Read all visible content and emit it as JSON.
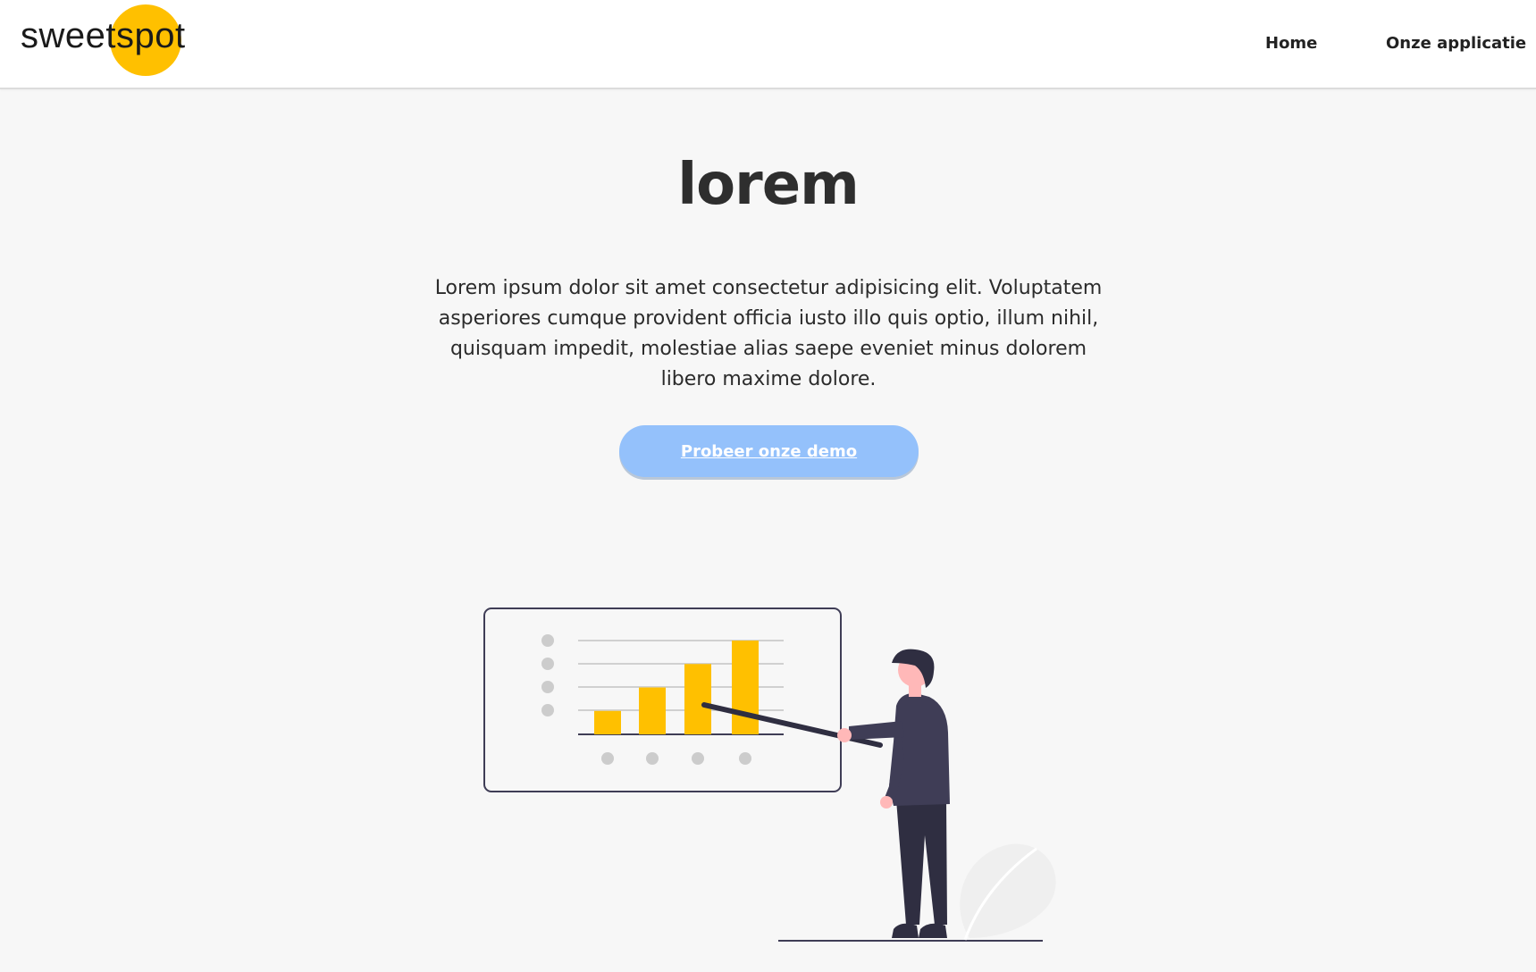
{
  "header": {
    "logo_text": "sweetspot",
    "nav": [
      {
        "label": "Home"
      },
      {
        "label": "Onze applicatie"
      }
    ]
  },
  "hero": {
    "title": "lorem",
    "description": "Lorem ipsum dolor sit amet consectetur adipisicing elit. Voluptatem asperiores cumque provident officia iusto illo quis optio, illum nihil, quisquam impedit, molestiae alias saepe eveniet minus dolorem libero maxime dolore.",
    "cta_label": "Probeer onze demo"
  },
  "illustration": {
    "bar_values": [
      1,
      2,
      3,
      4
    ],
    "colors": {
      "brand_yellow": "#ffc000",
      "button_blue": "#94c1fb",
      "suit_dark": "#3f3d56",
      "pants_dark": "#2f2e41",
      "skin": "#ffb8b8",
      "gray_dots": "#cccccc"
    }
  }
}
